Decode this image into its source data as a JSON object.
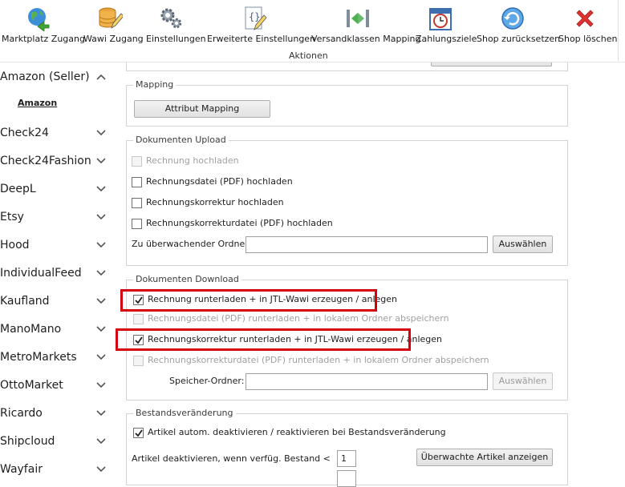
{
  "toolbar": {
    "buttons": [
      {
        "label": "Marktplatz Zugang",
        "icon": "globe-refresh-icon"
      },
      {
        "label": "Wawi Zugang",
        "icon": "database-edit-icon"
      },
      {
        "label": "Einstellungen",
        "icon": "gears-icon"
      },
      {
        "label": "Erweiterte Einstellungen",
        "icon": "code-document-edit-icon"
      },
      {
        "label": "Versandklassen Mapping",
        "icon": "mapping-arrows-icon"
      },
      {
        "label": "Zahlungsziele",
        "icon": "calendar-clock-icon"
      },
      {
        "label": "Shop zurücksetzen",
        "icon": "reset-arrow-icon"
      },
      {
        "label": "Shop löschen",
        "icon": "red-x-icon"
      }
    ],
    "group_label": "Aktionen"
  },
  "sidebar": {
    "items": [
      {
        "label": "Amazon (Seller)",
        "expanded": true
      },
      {
        "label": "Check24"
      },
      {
        "label": "Check24Fashion"
      },
      {
        "label": "DeepL"
      },
      {
        "label": "Etsy"
      },
      {
        "label": "Hood"
      },
      {
        "label": "IndividualFeed"
      },
      {
        "label": "Kaufland"
      },
      {
        "label": "ManoMano"
      },
      {
        "label": "MetroMarkets"
      },
      {
        "label": "OttoMarket"
      },
      {
        "label": "Ricardo"
      },
      {
        "label": "Shipcloud"
      },
      {
        "label": "Wayfair"
      }
    ],
    "sub_item": "Amazon"
  },
  "mapping": {
    "legend": "Mapping",
    "button": "Attribut Mapping"
  },
  "upload": {
    "legend": "Dokumenten Upload",
    "checkboxes": [
      {
        "label": "Rechnung hochladen",
        "checked": false,
        "disabled": true
      },
      {
        "label": "Rechnungsdatei (PDF) hochladen",
        "checked": false,
        "disabled": false
      },
      {
        "label": "Rechnungskorrektur hochladen",
        "checked": false,
        "disabled": false
      },
      {
        "label": "Rechnungskorrekturdatei (PDF) hochladen",
        "checked": false,
        "disabled": false
      }
    ],
    "folder_label": "Zu überwachender Ordner:",
    "folder_value": "",
    "choose_button": "Auswählen"
  },
  "download": {
    "legend": "Dokumenten Download",
    "checkboxes": [
      {
        "label": "Rechnung runterladen + in JTL-Wawi erzeugen / anlegen",
        "checked": true,
        "disabled": false
      },
      {
        "label": "Rechnungsdatei (PDF) runterladen + in lokalem Ordner abspeichern",
        "checked": false,
        "disabled": true
      },
      {
        "label": "Rechnungskorrektur runterladen + in JTL-Wawi erzeugen / anlegen",
        "checked": true,
        "disabled": false
      },
      {
        "label": "Rechnungskorrekturdatei (PDF) runterladen + in lokalem Ordner abspeichern",
        "checked": false,
        "disabled": true
      }
    ],
    "folder_label": "Speicher-Ordner:",
    "folder_value": "",
    "choose_button": "Auswählen"
  },
  "stock": {
    "legend": "Bestandsveränderung",
    "checkbox": {
      "label": "Artikel autom. deaktivieren / reaktivieren bei Bestandsveränderung",
      "checked": true
    },
    "threshold_label": "Artikel deaktivieren, wenn verfüg. Bestand <",
    "threshold_value": "1",
    "watched_button": "Überwachte Artikel anzeigen"
  },
  "colors": {
    "highlight": "#d7000f",
    "border": "#d4d4d4"
  }
}
